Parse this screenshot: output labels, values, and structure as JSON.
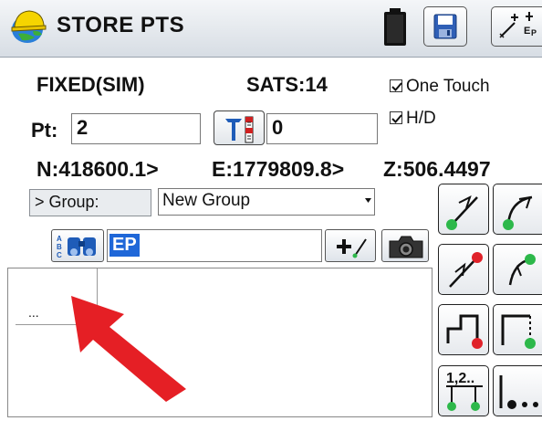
{
  "window": {
    "title": "STORE PTS",
    "icons": [
      "app-logo-icon",
      "battery-icon",
      "save-icon",
      "points-icon"
    ]
  },
  "status": {
    "solution": "FIXED(SIM)",
    "sats": "SATS:14",
    "one_touch_label": "One Touch",
    "one_touch_checked": true,
    "hd_label": "H/D",
    "hd_checked": true
  },
  "point": {
    "label": "Pt:",
    "value": "2",
    "rod_height": "0"
  },
  "coordinates": {
    "n": "N:418600.1>",
    "e": "E:1779809.8>",
    "z": "Z:506.4497"
  },
  "group": {
    "label": "> Group:",
    "selected": "New Group"
  },
  "code": {
    "value": "EP"
  },
  "list": {
    "cell_text": "..."
  },
  "side_tools": [
    "store-arc-button",
    "store-arc-curve-button",
    "store-line-end-button",
    "store-curve-end-button",
    "store-corner-button",
    "store-rectangle-button",
    "store-sequence-button",
    "more-options-button"
  ],
  "colors": {
    "highlight": "#1f67d8",
    "node_green": "#2db84a",
    "node_red": "#e0222a",
    "annotation_arrow": "#e51f25"
  }
}
